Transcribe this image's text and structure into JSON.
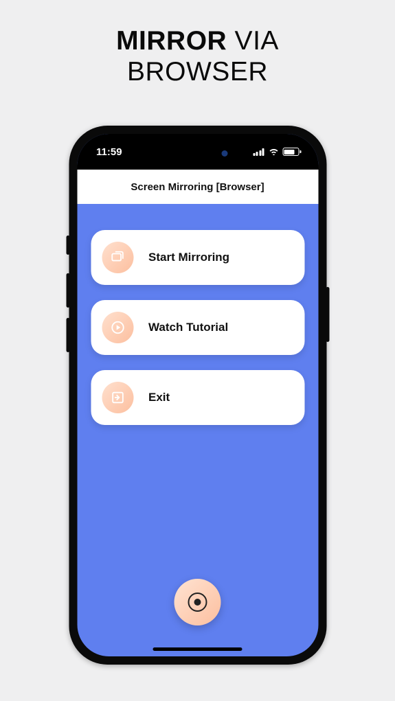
{
  "heading": {
    "line1_bold": "MIRROR",
    "line1_rest": " VIA",
    "line2": "BROWSER"
  },
  "status": {
    "time": "11:59"
  },
  "header": {
    "title": "Screen Mirroring [Browser]"
  },
  "menu": {
    "start": {
      "label": "Start Mirroring",
      "icon": "cast-icon"
    },
    "tutorial": {
      "label": "Watch Tutorial",
      "icon": "play-icon"
    },
    "exit": {
      "label": "Exit",
      "icon": "exit-icon"
    }
  },
  "colors": {
    "accent": "#5f7fef",
    "peach_light": "#ffe0ce",
    "peach_dark": "#fcbf9f"
  }
}
